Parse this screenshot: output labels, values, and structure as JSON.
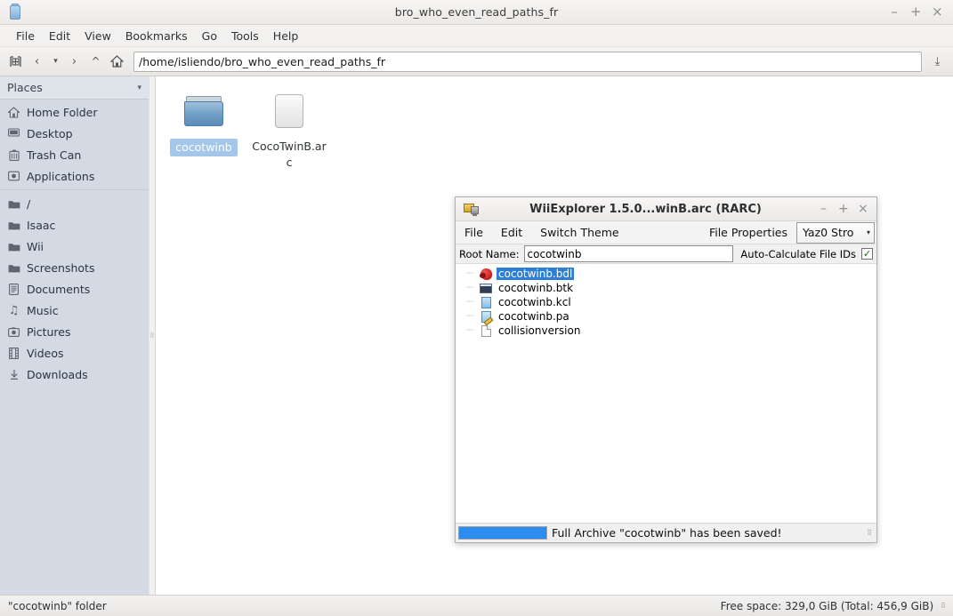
{
  "file_manager": {
    "title": "bro_who_even_read_paths_fr",
    "window_icon": "file-manager-icon",
    "window_buttons": {
      "minimize": "–",
      "maximize": "+",
      "close": "×"
    },
    "menus": [
      "File",
      "Edit",
      "View",
      "Bookmarks",
      "Go",
      "Tools",
      "Help"
    ],
    "toolbar": {
      "new_tab_icon": "new-tab-icon",
      "back_icon": "‹",
      "history_icon": "▾",
      "forward_icon": "›",
      "up_icon": "^",
      "home_icon": "home-icon",
      "path_value": "/home/isliendo/bro_who_even_read_paths_fr",
      "dropdown_icon": "⤓"
    },
    "sidebar": {
      "header": "Places",
      "header_caret": "▾",
      "groups": [
        [
          {
            "label": "Home Folder",
            "icon": "home-icon",
            "glyph": "⌂"
          },
          {
            "label": "Desktop",
            "icon": "desktop-icon",
            "glyph": "▣"
          },
          {
            "label": "Trash Can",
            "icon": "trash-icon",
            "glyph": "▥"
          },
          {
            "label": "Applications",
            "icon": "applications-icon",
            "glyph": "◎"
          }
        ],
        [
          {
            "label": "/",
            "icon": "folder-icon",
            "glyph": "▬"
          },
          {
            "label": "Isaac",
            "icon": "folder-icon",
            "glyph": "▬"
          },
          {
            "label": "Wii",
            "icon": "folder-icon",
            "glyph": "▬"
          },
          {
            "label": "Screenshots",
            "icon": "folder-icon",
            "glyph": "▬"
          },
          {
            "label": "Documents",
            "icon": "documents-icon",
            "glyph": "▤"
          },
          {
            "label": "Music",
            "icon": "music-icon",
            "glyph": "♫"
          },
          {
            "label": "Pictures",
            "icon": "pictures-icon",
            "glyph": "◉"
          },
          {
            "label": "Videos",
            "icon": "videos-icon",
            "glyph": "▦"
          },
          {
            "label": "Downloads",
            "icon": "downloads-icon",
            "glyph": "⇓"
          }
        ]
      ]
    },
    "files": [
      {
        "name": "cocotwinb",
        "type": "folder",
        "selected": true
      },
      {
        "name": "CocoTwinB.arc",
        "type": "file",
        "selected": false
      }
    ],
    "statusbar": {
      "left": "\"cocotwinb\" folder",
      "right": "Free space: 329,0 GiB (Total: 456,9 GiB)"
    }
  },
  "wii_explorer": {
    "title": "WiiExplorer 1.5.0...winB.arc (RARC)",
    "window_icon": "archive-icon",
    "window_buttons": {
      "minimize": "–",
      "maximize": "+",
      "close": "×"
    },
    "menus": [
      "File",
      "Edit",
      "Switch Theme"
    ],
    "right_menus": [
      "File Properties"
    ],
    "compression": {
      "selected": "Yaz0 Stro",
      "caret": "▾"
    },
    "root_name": {
      "label": "Root Name:",
      "value": "cocotwinb"
    },
    "auto_calculate": {
      "label": "Auto-Calculate File IDs",
      "checked": true,
      "check_glyph": "✓"
    },
    "tree": [
      {
        "label": "cocotwinb.bdl",
        "icon": "bdl-model-icon",
        "selected": true
      },
      {
        "label": "cocotwinb.btk",
        "icon": "btk-texture-anim-icon",
        "selected": false
      },
      {
        "label": "cocotwinb.kcl",
        "icon": "kcl-collision-icon",
        "selected": false
      },
      {
        "label": "cocotwinb.pa",
        "icon": "pa-file-icon",
        "selected": false
      },
      {
        "label": "collisionversion",
        "icon": "plain-file-icon",
        "selected": false
      }
    ],
    "statusbar": {
      "progress_percent": 100,
      "progress_color": "#2d8cf0",
      "message": "Full Archive \"cocotwinb\" has been saved!"
    }
  }
}
